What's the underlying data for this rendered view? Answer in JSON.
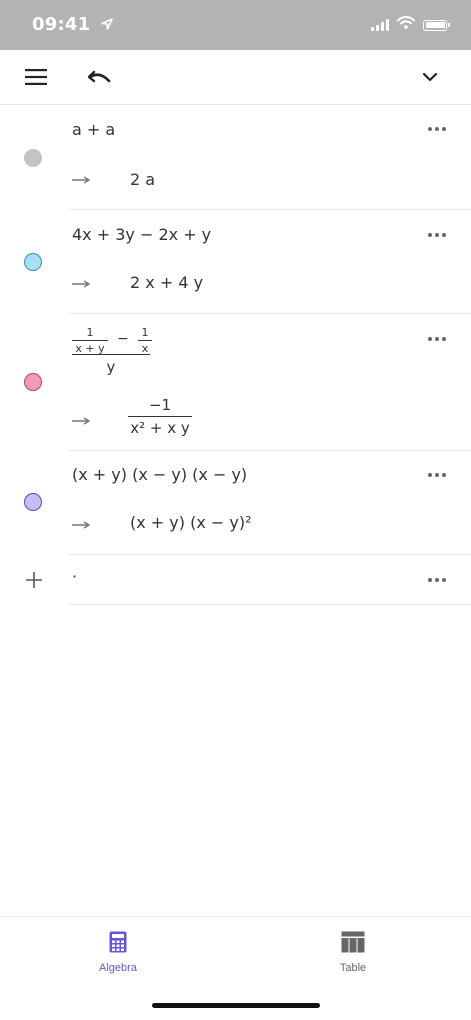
{
  "status": {
    "time": "09:41"
  },
  "toolbar": {
    "menu_icon": "hamburger-menu-icon",
    "undo_icon": "undo-icon",
    "collapse_icon": "chevron-down-icon"
  },
  "entries": [
    {
      "color": "#c4c4c4",
      "input": "a  +  a",
      "output": "2 a"
    },
    {
      "color": "#a8dff2",
      "input": "4x  +  3y  −  2x  +  y",
      "output": "2 x + 4 y"
    },
    {
      "color": "#f29cb3",
      "input": {
        "inner_num": "1",
        "inner_den": "x + y",
        "minus": "−",
        "second_num": "1",
        "second_den": "x",
        "den": "y"
      },
      "output": {
        "num": "−1",
        "den": "x² + x y"
      }
    },
    {
      "color": "#c6bdf2",
      "input": "(x  +  y)  (x  −  y)  (x  −  y)",
      "output": "(x + y) (x − y)²"
    }
  ],
  "new_entry": {
    "add_icon": "plus-icon",
    "placeholder": "·"
  },
  "bottom_nav": {
    "items": [
      {
        "label": "Algebra",
        "icon": "calculator-icon",
        "active": true,
        "color": "#6557d2"
      },
      {
        "label": "Table",
        "icon": "table-icon",
        "active": false,
        "color": "#666666"
      }
    ]
  }
}
